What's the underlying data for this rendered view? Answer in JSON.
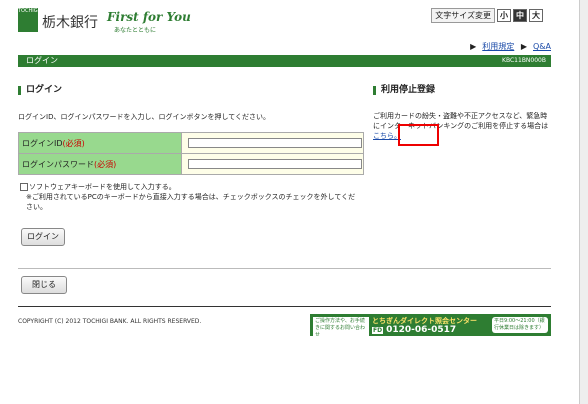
{
  "header": {
    "logo_text": "TOCHIGI",
    "bank_name": "栃木銀行",
    "tagline": "First for You",
    "tagline_sub": "あなたとともに",
    "fontsize_label": "文字サイズ変更",
    "sizes": [
      "小",
      "中",
      "大"
    ]
  },
  "links": {
    "terms": "利用規定",
    "qa": "Q&A"
  },
  "titlebar": {
    "title": "ログイン",
    "code": "KBC11BN000B"
  },
  "login": {
    "section_title": "ログイン",
    "description": "ログインID、ログインパスワードを入力し、ログインボタンを押してください。",
    "id_label": "ログインID",
    "password_label": "ログインパスワード",
    "required": "(必須)",
    "software_keyboard": "ソフトウェアキーボードを使用して入力する。",
    "software_note": "※ご利用されているPCのキーボードから直接入力する場合は、チェックボックスのチェックを外してください。",
    "login_button": "ログイン"
  },
  "suspend": {
    "section_title": "利用停止登録",
    "text_before": "ご利用カードの紛失・盗難や不正アクセスなど、緊急時にインターネットバンキングのご利用を停止する場合は",
    "link": "こちら。"
  },
  "close_button": "閉じる",
  "footer": {
    "copyright": "COPYRIGHT (C) 2012 TOCHIGI BANK. ALL RIGHTS RESERVED.",
    "contact_question": "ご操作方法や、お手続きに関するお問い合わせ",
    "center_name": "とちぎんダイレクト照会センター",
    "phone": "0120-06-0517",
    "hours": "平日9:00～21:00（銀行休業日は除きます）"
  },
  "colors": {
    "brand_green": "#2e7d32",
    "label_green": "#98d98e",
    "link_blue": "#1a4aa8",
    "highlight_red": "#ee0000"
  }
}
